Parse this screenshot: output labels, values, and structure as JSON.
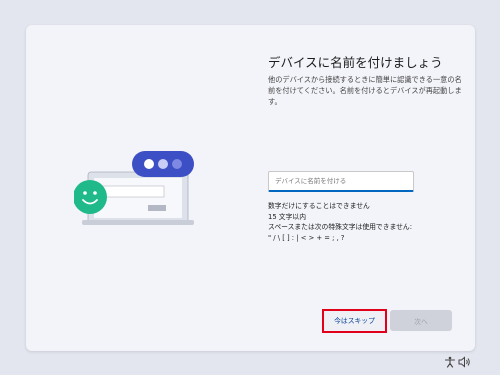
{
  "page": {
    "title": "デバイスに名前を付けましょう",
    "description": "他のデバイスから接続するときに簡単に認識できる一意の名前を付けてください。名前を付けるとデバイスが再起動します。"
  },
  "name_field": {
    "placeholder": "デバイスに名前を付ける",
    "value": ""
  },
  "rules": {
    "line1": "数字だけにすることはできません",
    "line2": "15 文字以内",
    "line3": "スペースまたは次の特殊文字は使用できません:",
    "line4": "\" / \\ [ ] : | < > + = ; , ?"
  },
  "buttons": {
    "skip_label": "今はスキップ",
    "next_label": "次へ"
  },
  "tray": {
    "accessibility_icon": "accessibility-icon",
    "volume_icon": "volume-icon"
  },
  "colors": {
    "accent": "#0067c0",
    "highlight_border": "#e3001b",
    "bubble_blue": "#3d4fc4",
    "bubble_green": "#1fb98a"
  }
}
